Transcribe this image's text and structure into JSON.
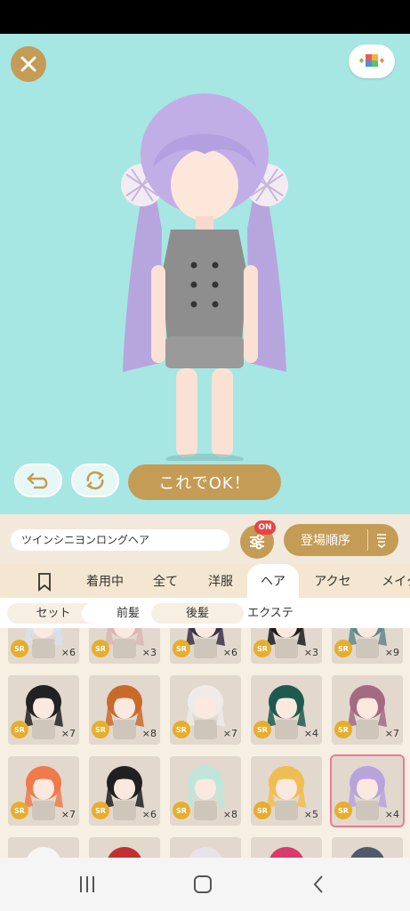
{
  "stage": {
    "ok_label": "これでOK！",
    "background_color": "#a6e6e3",
    "accent_color": "#c49c55"
  },
  "info": {
    "item_name": "ツインシニヨンロングヘア",
    "filter_badge": "ON",
    "sort_label": "登場順序"
  },
  "tabs": [
    {
      "label": "着用中"
    },
    {
      "label": "全て"
    },
    {
      "label": "洋服"
    },
    {
      "label": "ヘア",
      "active": true
    },
    {
      "label": "アクセ"
    },
    {
      "label": "メイク"
    }
  ],
  "subtabs": [
    {
      "label": "セット"
    },
    {
      "label": "前髪"
    },
    {
      "label": "後髪"
    },
    {
      "label": "エクステ"
    }
  ],
  "rarity_label": "SR",
  "items_row1": [
    {
      "count": "×6",
      "hair": "#d9e0f0"
    },
    {
      "count": "×3",
      "hair": "#d8b8b3"
    },
    {
      "count": "×6",
      "hair": "#3b3048"
    },
    {
      "count": "×3",
      "hair": "#1c1c1c"
    },
    {
      "count": "×9",
      "hair": "#5f8a88"
    }
  ],
  "items_row2": [
    {
      "count": "×7",
      "hair": "#222222"
    },
    {
      "count": "×8",
      "hair": "#c96a2a"
    },
    {
      "count": "×7",
      "hair": "#f0ebe8"
    },
    {
      "count": "×4",
      "hair": "#1f5a4f"
    },
    {
      "count": "×7",
      "hair": "#a46a82"
    }
  ],
  "items_row3": [
    {
      "count": "×7",
      "hair": "#f07a4a"
    },
    {
      "count": "×6",
      "hair": "#202020"
    },
    {
      "count": "×8",
      "hair": "#bfe6da"
    },
    {
      "count": "×5",
      "hair": "#f0bd52"
    },
    {
      "count": "×4",
      "hair": "#b9a3dd",
      "selected": true
    }
  ],
  "items_row4": [
    {
      "hair": "#f5f5f5"
    },
    {
      "hair": "#c03030"
    },
    {
      "hair": "#e8e2ea"
    },
    {
      "hair": "#d9396b"
    },
    {
      "hair": "#4f5a6e"
    }
  ]
}
